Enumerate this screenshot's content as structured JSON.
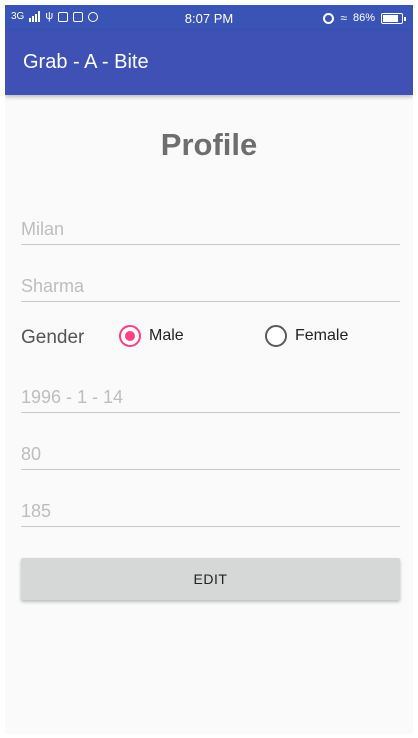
{
  "status_bar": {
    "network": "3G",
    "time": "8:07 PM",
    "battery_percent": "86%",
    "battery_level": 0.86,
    "icons": [
      "signal-icon",
      "usb-icon",
      "notification-icon",
      "notification-icon",
      "whatsapp-icon",
      "alarm-icon",
      "wifi-icon",
      "battery-icon"
    ]
  },
  "app_bar": {
    "title": "Grab - A - Bite",
    "color": "#3f51b5"
  },
  "profile": {
    "title": "Profile",
    "first_name_placeholder": "Milan",
    "last_name_placeholder": "Sharma",
    "gender_label": "Gender",
    "gender_options": [
      "Male",
      "Female"
    ],
    "gender_selected": "Male",
    "dob_placeholder": "1996 - 1 - 14",
    "weight_placeholder": "80",
    "height_placeholder": "185",
    "edit_button": "EDIT"
  },
  "colors": {
    "accent": "#ff4081",
    "primary": "#3f51b5"
  }
}
